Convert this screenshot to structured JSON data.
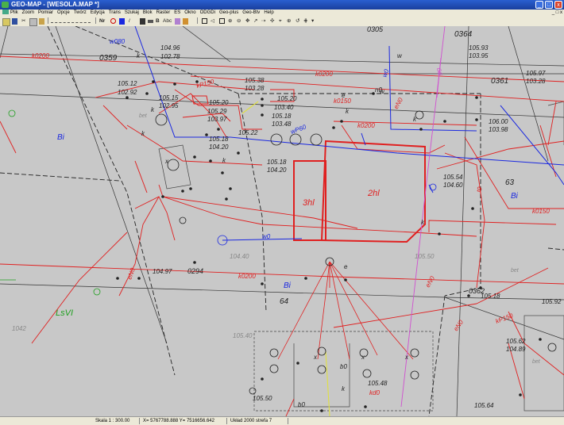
{
  "window": {
    "title": "GEO-MAP - [WESOLA.MAP *]",
    "minimize": "_",
    "maximize": "□",
    "close": "x"
  },
  "menu": {
    "items": [
      "Plik",
      "Zoom",
      "Pomiar",
      "Opcje",
      "Twórz",
      "Edycja",
      "Trans",
      "Szukaj",
      "Blok",
      "Raster",
      "ES",
      "Okno",
      "ODGDi",
      "Geo-plus",
      "Geo-Btv",
      "Help"
    ]
  },
  "toolbar": {
    "nr_label": "Nr",
    "bold_label": "B",
    "abc_label": "Abc",
    "rotate_icon": "↺",
    "target_icon": "⊕"
  },
  "map": {
    "parcels": [
      "0359",
      "0361",
      "0364",
      "63",
      "64",
      "0294",
      "0362",
      "0305"
    ],
    "land_use": [
      "Bi",
      "Bi",
      "Bi",
      "LsVI",
      "bet",
      "bet",
      "bet"
    ],
    "buildings": [
      "3hl",
      "2hl"
    ],
    "elevations": [
      "104.96",
      "102.78",
      "105.12",
      "102.92",
      "105.15",
      "102.95",
      "105.38",
      "103.28",
      "105.20",
      "103.40",
      "105.20",
      "105.18",
      "103.48",
      "105.29",
      "103.97",
      "105.18",
      "104.20",
      "105.22",
      "105.18",
      "104.20",
      "105.54",
      "104.60",
      "106.00",
      "103.98",
      "105.93",
      "103.95",
      "105.97",
      "103.28",
      "104.97",
      "104.40",
      "105.50",
      "105.62",
      "104.89",
      "105.50",
      "105.64",
      "105.40",
      "105.92",
      "105.18",
      "1042",
      "105.48"
    ],
    "lines": [
      "k0200",
      "k0200",
      "k0200",
      "k0200",
      "k0150",
      "k0150",
      "kP150",
      "kP150",
      "eN0",
      "eN0",
      "eN0",
      "eN0",
      "w0",
      "w0",
      "w080",
      "t0",
      "b0",
      "b0",
      "g0",
      "n0",
      "kd0",
      "wP60"
    ],
    "markers": [
      "k",
      "k",
      "k",
      "k",
      "k",
      "k",
      "k",
      "k",
      "x",
      "x",
      "x",
      "x",
      "e",
      "w",
      "w",
      "e"
    ]
  },
  "status": {
    "scale": "Skala 1 : 300.00",
    "coords": "X= 5767788.888  Y= 7516656.642",
    "system": "Układ 2000 strefa 7"
  },
  "colors": {
    "titlebar": "#2a5fd0",
    "canvas": "#c8c8c8",
    "red": "#e02020",
    "blue": "#1a28e0",
    "dark": "#222222",
    "magenta": "#d050d0"
  }
}
